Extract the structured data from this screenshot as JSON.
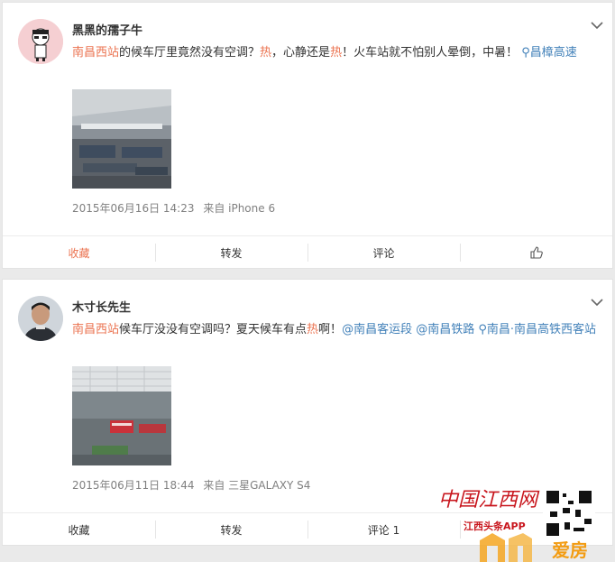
{
  "posts": [
    {
      "username": "黑黑的孺子牛",
      "text_parts": [
        {
          "t": "南昌西站",
          "c": "tag"
        },
        {
          "t": "的候车厅里竟然没有空调？",
          "c": ""
        },
        {
          "t": "热",
          "c": "hot"
        },
        {
          "t": "，心静还是",
          "c": ""
        },
        {
          "t": "热",
          "c": "hot"
        },
        {
          "t": "！火车站就不怕别人晕倒，中暑！ ",
          "c": ""
        },
        {
          "t": "⚲昌樟高速",
          "c": "link"
        }
      ],
      "time": "2015年06月16日 14:23",
      "source": "来自 iPhone 6",
      "actions": {
        "favorite": "收藏",
        "repost": "转发",
        "comment": "评论",
        "like": ""
      }
    },
    {
      "username": "木寸长先生",
      "text_parts": [
        {
          "t": "南昌西站",
          "c": "tag"
        },
        {
          "t": "候车厅没没有空调吗？夏天候车有点",
          "c": ""
        },
        {
          "t": "热",
          "c": "hot"
        },
        {
          "t": "啊！",
          "c": ""
        },
        {
          "t": "@南昌客运段",
          "c": "link"
        },
        {
          "t": " ",
          "c": ""
        },
        {
          "t": "@南昌铁路",
          "c": "link"
        },
        {
          "t": " ",
          "c": ""
        },
        {
          "t": "⚲南昌·南昌高铁西客站",
          "c": "link"
        }
      ],
      "time": "2015年06月11日 18:44",
      "source": "来自 三星GALAXY S4",
      "actions": {
        "favorite": "收藏",
        "repost": "转发",
        "comment": "评论 1",
        "like": ""
      }
    }
  ],
  "watermark": {
    "site": "中国江西网",
    "app": "江西头条APP",
    "brand": "爱房"
  },
  "colors": {
    "accent": "#eb7350",
    "link": "#4281b9"
  }
}
